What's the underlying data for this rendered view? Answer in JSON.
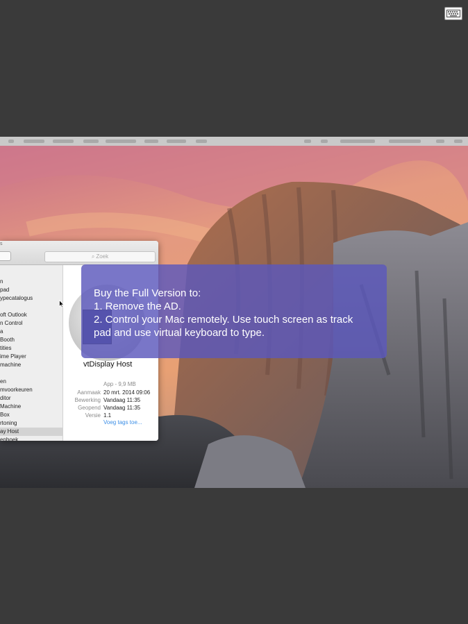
{
  "keyboard": {
    "icon": "keyboard-icon"
  },
  "finder": {
    "title": "s",
    "search_placeholder": "Zoek",
    "sidebar_items": [
      "n",
      "pad",
      "ypecatalogus",
      "oft Outlook",
      "n Control",
      "a",
      "Booth",
      "tities",
      "ime Player",
      "machine",
      "en",
      "mvoorkeuren",
      "ditor",
      "Machine",
      "Box",
      "rtoning",
      "ay Host",
      "enboek"
    ],
    "selected_item": "ay Host",
    "preview": {
      "app_name": "vtDisplay Host",
      "kind": "App - 9,9 MB",
      "info": [
        {
          "label": "Aanmaak",
          "value": "20 mrt. 2014 09:06"
        },
        {
          "label": "Bewerking",
          "value": "Vandaag 11:35"
        },
        {
          "label": "Geopend",
          "value": "Vandaag 11:35"
        },
        {
          "label": "Versie",
          "value": "1.1"
        }
      ],
      "add_tags": "Voeg tags toe..."
    }
  },
  "ad": {
    "lines": [
      "Buy the Full Version to:",
      "1. Remove the AD.",
      "2. Control your Mac remotely. Use touch screen as track",
      "pad and use virtual keyboard to type."
    ]
  },
  "colors": {
    "background": "#3a3a3a",
    "banner": "#5c58bc",
    "link": "#3b8ee6"
  }
}
